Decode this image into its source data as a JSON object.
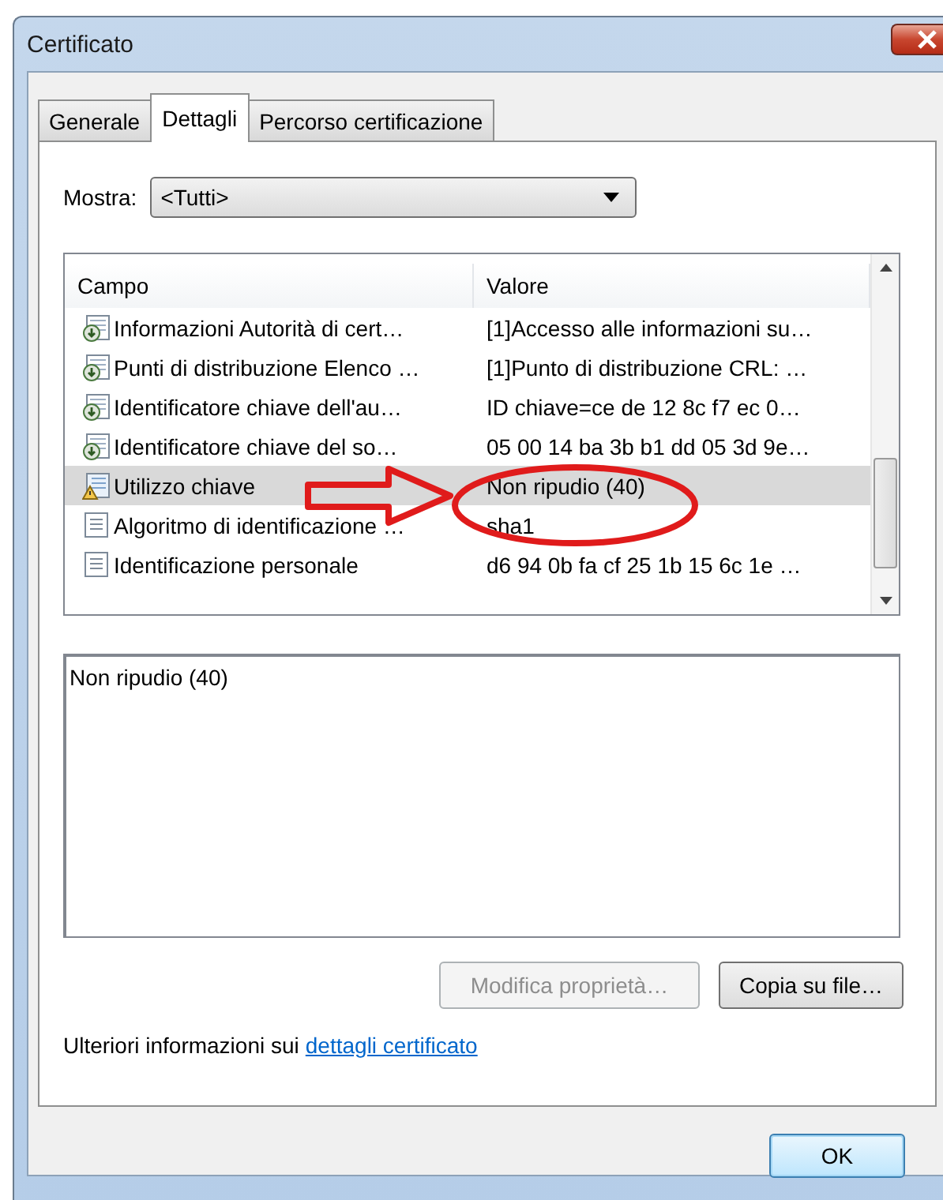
{
  "window": {
    "title": "Certificato"
  },
  "tabs": [
    {
      "label": "Generale",
      "selected": false
    },
    {
      "label": "Dettagli",
      "selected": true
    },
    {
      "label": "Percorso certificazione",
      "selected": false
    }
  ],
  "show": {
    "label": "Mostra:",
    "value": "<Tutti>"
  },
  "fields_table": {
    "columns": [
      "Campo",
      "Valore"
    ],
    "rows": [
      {
        "kind": "extension",
        "field": "Informazioni Autorità di cert…",
        "value": "[1]Accesso alle informazioni su…",
        "selected": false
      },
      {
        "kind": "extension",
        "field": "Punti di distribuzione Elenco …",
        "value": "[1]Punto di distribuzione CRL: …",
        "selected": false
      },
      {
        "kind": "extension",
        "field": "Identificatore chiave dell'au…",
        "value": "ID chiave=ce de 12 8c f7 ec 0…",
        "selected": false
      },
      {
        "kind": "extension",
        "field": "Identificatore chiave del so…",
        "value": "05 00 14 ba 3b b1 dd 05 3d 9e…",
        "selected": false
      },
      {
        "kind": "critical",
        "field": "Utilizzo chiave",
        "value": "Non ripudio (40)",
        "selected": true
      },
      {
        "kind": "property",
        "field": "Algoritmo di identificazione …",
        "value": "sha1",
        "selected": false
      },
      {
        "kind": "property",
        "field": "Identificazione personale",
        "value": "d6 94 0b fa cf 25 1b 15 6c 1e …",
        "selected": false
      }
    ]
  },
  "detail_text": "Non ripudio (40)",
  "buttons": [
    {
      "label": "Modifica proprietà…",
      "disabled": true
    },
    {
      "label": "Copia su file…",
      "disabled": false
    }
  ],
  "info": {
    "text": "Ulteriori informazioni sui",
    "link": "dettagli certificato"
  },
  "ok_button": {
    "label": "OK"
  }
}
